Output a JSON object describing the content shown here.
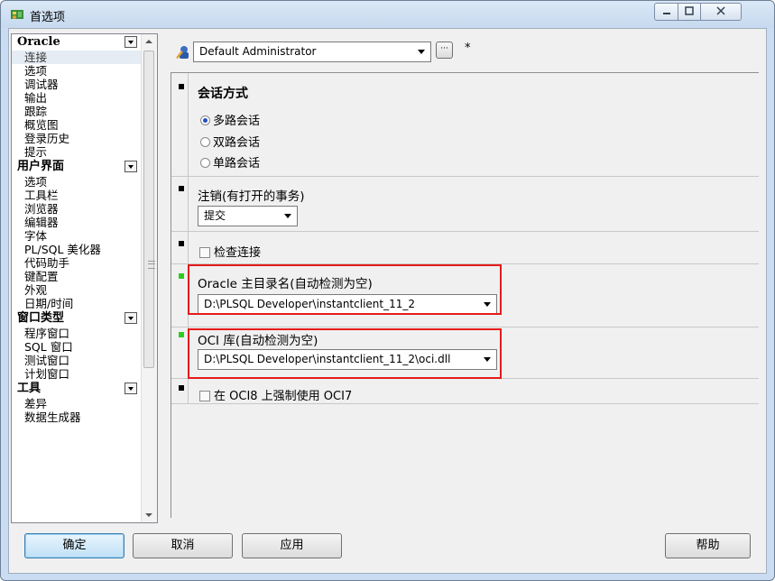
{
  "window": {
    "title": "首选项",
    "controls": [
      "minimize",
      "maximize",
      "close"
    ]
  },
  "tree": {
    "categories": [
      {
        "label": "Oracle",
        "items": [
          "连接",
          "选项",
          "调试器",
          "输出",
          "跟踪",
          "概览图",
          "登录历史",
          "提示"
        ],
        "selected": "连接"
      },
      {
        "label": "用户界面",
        "items": [
          "选项",
          "工具栏",
          "浏览器",
          "编辑器",
          "字体",
          "PL/SQL 美化器",
          "代码助手",
          "键配置",
          "外观",
          "日期/时间"
        ]
      },
      {
        "label": "窗口类型",
        "items": [
          "程序窗口",
          "SQL 窗口",
          "测试窗口",
          "计划窗口"
        ]
      },
      {
        "label": "工具",
        "items": [
          "差异",
          "数据生成器"
        ]
      }
    ]
  },
  "profile": {
    "value": "Default Administrator",
    "more_label": "···",
    "asterisk": "*"
  },
  "sections": {
    "session_mode": {
      "title": "会话方式",
      "options": [
        "多路会话",
        "双路会话",
        "单路会话"
      ],
      "selected": "多路会话"
    },
    "logoff": {
      "title": "注销(有打开的事务)",
      "value": "提交"
    },
    "check_connection": {
      "label": "检查连接",
      "checked": false
    },
    "oracle_home": {
      "title": "Oracle 主目录名(自动检测为空)",
      "value": "D:\\PLSQL Developer\\instantclient_11_2"
    },
    "oci_library": {
      "title": "OCI 库(自动检测为空)",
      "value": "D:\\PLSQL Developer\\instantclient_11_2\\oci.dll"
    },
    "force_oci7": {
      "label": "在 OCI8 上强制使用 OCI7",
      "checked": false
    }
  },
  "buttons": {
    "ok": "确定",
    "cancel": "取消",
    "apply": "应用",
    "help": "帮助"
  },
  "colors": {
    "highlight_box": "#e41b1b",
    "marker_changed": "#2ecc1e",
    "marker_default": "#000000",
    "selected_item_bg": "#e6ecf4"
  }
}
